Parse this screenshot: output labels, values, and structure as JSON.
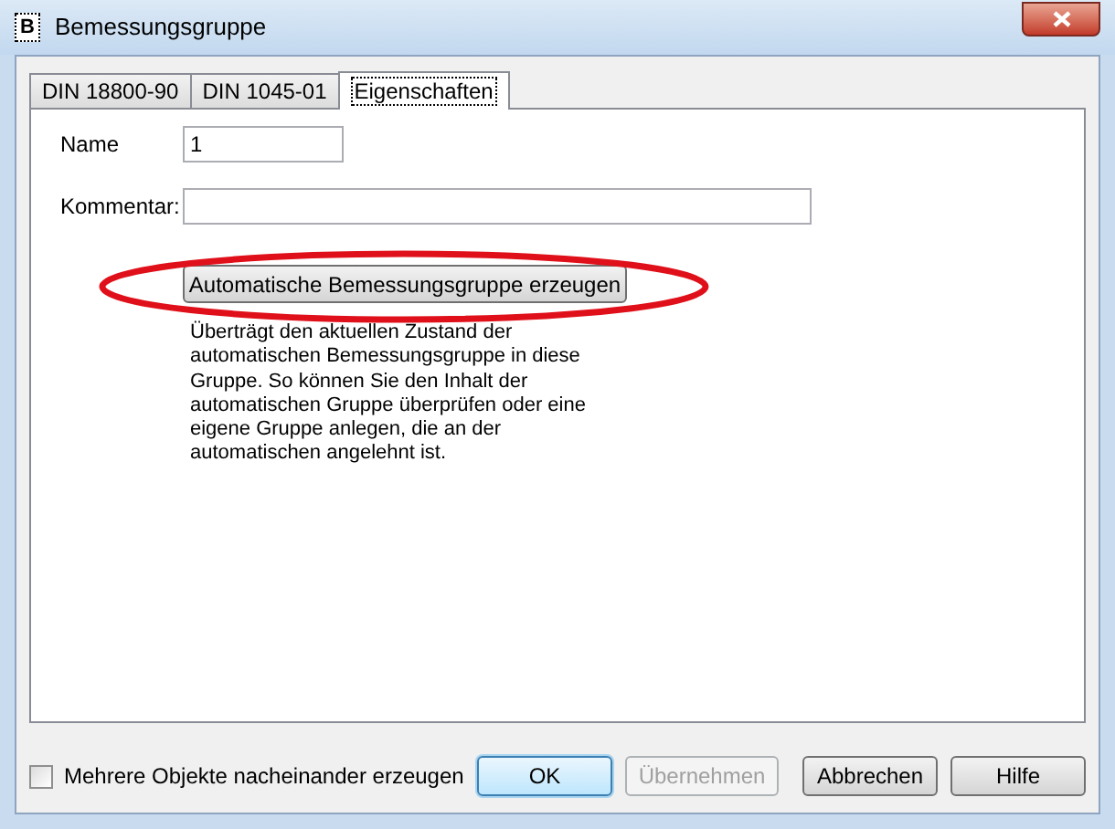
{
  "window": {
    "icon_letter": "B",
    "title": "Bemessungsgruppe"
  },
  "tabs": [
    {
      "label": "DIN 18800-90",
      "selected": false
    },
    {
      "label": "DIN 1045-01",
      "selected": false
    },
    {
      "label": "Eigenschaften",
      "selected": true
    }
  ],
  "form": {
    "name_label": "Name",
    "name_value": "1",
    "comment_label": "Kommentar:"
  },
  "generate_button": "Automatische Bemessungsgruppe erzeugen",
  "description": "Überträgt den aktuellen Zustand der automatischen Bemessungsgruppe in diese Gruppe. So können Sie den Inhalt der automatischen Gruppe überprüfen oder eine eigene Gruppe anlegen, die an der automatischen angelehnt ist.",
  "multi_create": {
    "label": "Mehrere Objekte nacheinander erzeugen",
    "checked": false
  },
  "buttons": [
    {
      "label": "OK",
      "disabled": false,
      "default": true
    },
    {
      "label": "Übernehmen",
      "disabled": true,
      "default": false
    },
    {
      "label": "Abbrechen",
      "disabled": false,
      "default": false
    },
    {
      "label": "Hilfe",
      "disabled": false,
      "default": false
    }
  ]
}
